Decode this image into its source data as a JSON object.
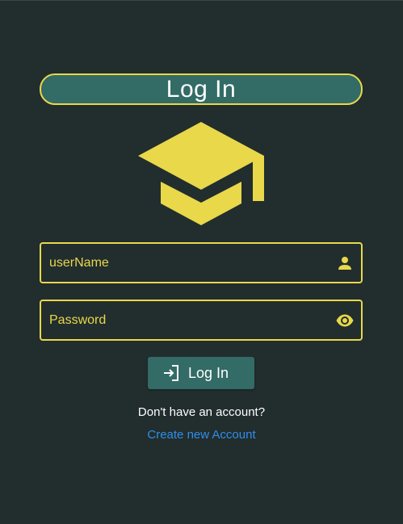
{
  "header": {
    "title": "Log In"
  },
  "logo": {
    "icon": "graduation-cap-icon",
    "color": "#e8d84a"
  },
  "form": {
    "username": {
      "placeholder": "userName",
      "value": "",
      "icon": "person-icon"
    },
    "password": {
      "placeholder": "Password",
      "value": "",
      "icon": "eye-icon"
    },
    "submit": {
      "label": "Log In",
      "icon": "login-icon"
    }
  },
  "footer": {
    "prompt": "Don't have an account?",
    "create_link": "Create new Account"
  },
  "colors": {
    "background": "#222d2e",
    "accent": "#e8d84a",
    "primary": "#336b66",
    "link": "#2f8fe8"
  }
}
